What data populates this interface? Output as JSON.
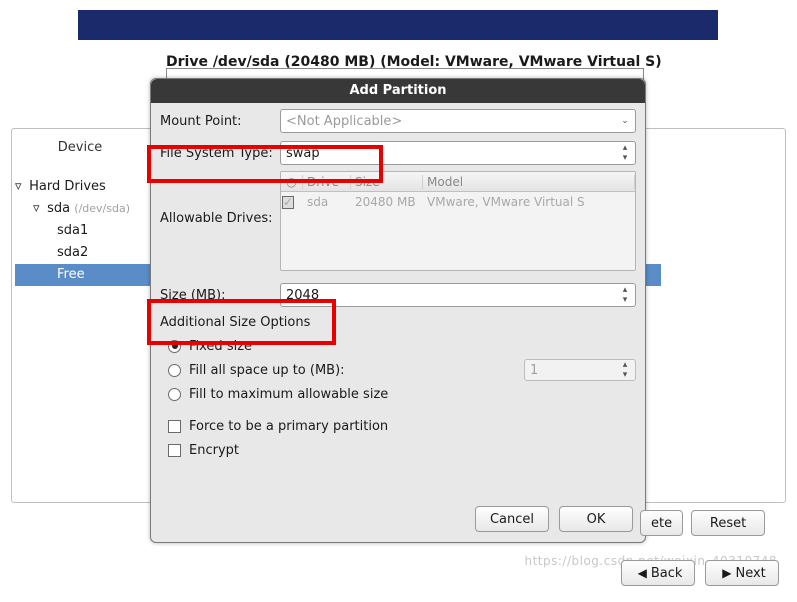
{
  "banner": {},
  "drive_header": "Drive /dev/sda (20480 MB) (Model: VMware, VMware Virtual S)",
  "device_col_label": "Device",
  "tree": {
    "root": "Hard Drives",
    "disk": "sda",
    "disk_path": "(/dev/sda)",
    "p1": "sda1",
    "p2": "sda2",
    "free": "Free"
  },
  "modal": {
    "title": "Add Partition",
    "mount_label": "Mount Point:",
    "mount_placeholder": "<Not Applicable>",
    "fstype_label": "File System Type:",
    "fstype_value": "swap",
    "allowdrives_label": "Allowable Drives:",
    "drives_table": {
      "head": {
        "chk": "○",
        "drive": "Drive",
        "size": "Size",
        "model": "Model"
      },
      "row": {
        "drive": "sda",
        "size": "20480 MB",
        "model": "VMware, VMware Virtual S"
      }
    },
    "size_label": "Size (MB):",
    "size_value": "2048",
    "addl_title": "Additional Size Options",
    "radio_fixed": "Fixed size",
    "radio_fillupto": "Fill all space up to (MB):",
    "fillupto_value": "1",
    "radio_fillmax": "Fill to maximum allowable size",
    "chk_primary": "Force to be a primary partition",
    "chk_encrypt": "Encrypt",
    "cancel": "Cancel",
    "ok": "OK"
  },
  "toolbar": {
    "delete_partial": "ete",
    "reset": "Reset"
  },
  "nav": {
    "back": "Back",
    "next": "Next"
  },
  "watermark": "https://blog.csdn.net/weixin_40310748"
}
